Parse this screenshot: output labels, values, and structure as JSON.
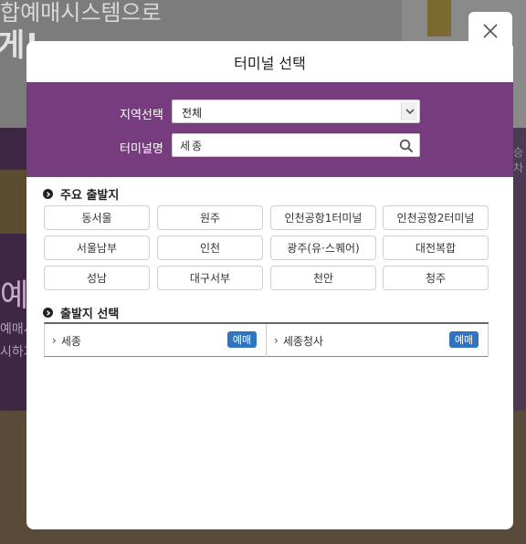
{
  "background": {
    "title_text": "합예매시스템으로",
    "big_text": "게!",
    "ye_text": "예",
    "line1": "예매시",
    "line2": "시하거",
    "right_text": "승차"
  },
  "modal": {
    "title": "터미널 선택",
    "close_icon": "close-icon"
  },
  "search": {
    "region_label": "지역선택",
    "region_value": "전체",
    "terminal_label": "터미널명",
    "terminal_value": "세종"
  },
  "major": {
    "title": "주요 출발지",
    "items": [
      "동서울",
      "원주",
      "인천공항1터미널",
      "인천공항2터미널",
      "서울남부",
      "인천",
      "광주(유·스퀘어)",
      "대전복합",
      "성남",
      "대구서부",
      "천안",
      "청주"
    ]
  },
  "departure": {
    "title": "출발지 선택",
    "items": [
      {
        "name": "세종",
        "button": "예매"
      },
      {
        "name": "세종청사",
        "button": "예매"
      }
    ]
  },
  "colors": {
    "panel_purple": "#773c7e",
    "book_blue": "#2f74c0"
  }
}
